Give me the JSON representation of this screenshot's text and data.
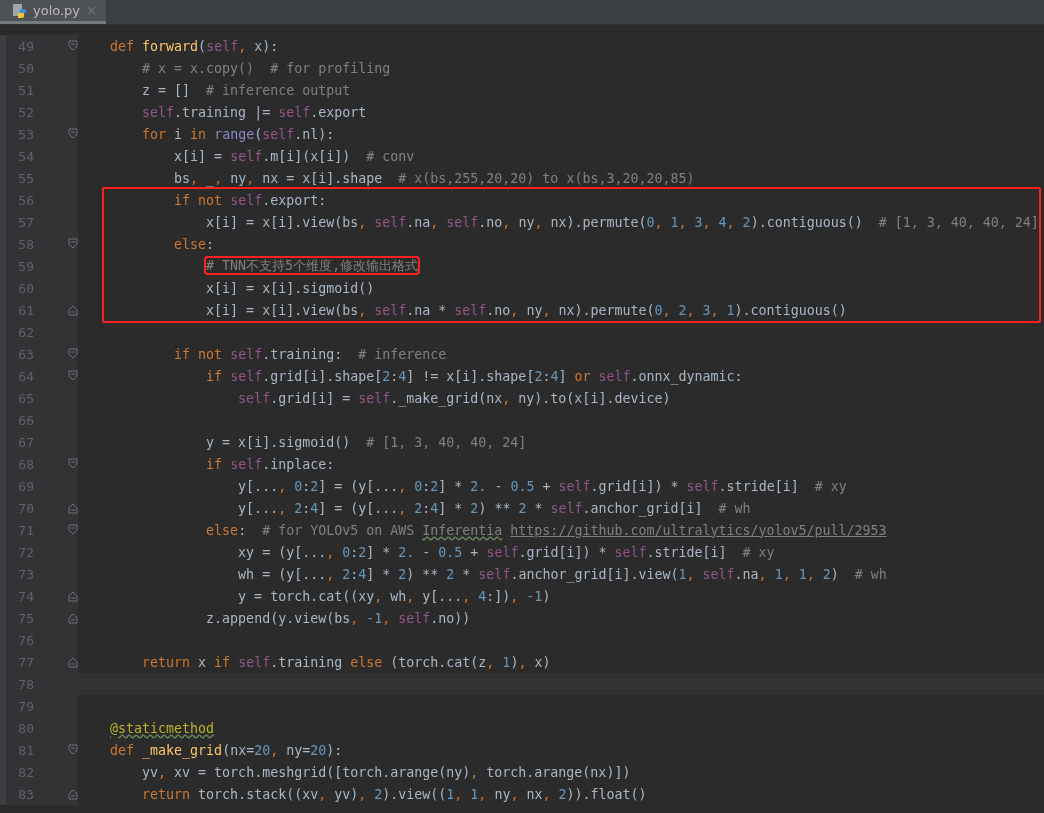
{
  "tab": {
    "title": "yolo.py",
    "selected": true
  },
  "blocks": [
    {
      "kind": "plain",
      "lines": [
        {
          "number": "49",
          "fold_open": true,
          "tokens": [
            {
              "kind": "kw",
              "text": "    def "
            },
            {
              "kind": "fn",
              "text": "forward"
            },
            {
              "kind": "tx",
              "text": "("
            },
            {
              "kind": "self",
              "text": "self"
            },
            {
              "kind": "pu",
              "text": ", "
            },
            {
              "kind": "tx",
              "text": "x):"
            }
          ]
        },
        {
          "number": "50",
          "tokens": [
            {
              "kind": "cm",
              "text": "        # x = x.copy()  # for profiling"
            }
          ]
        },
        {
          "number": "51",
          "tokens": [
            {
              "kind": "tx",
              "text": "        z = []  "
            },
            {
              "kind": "cm",
              "text": "# inference output"
            }
          ]
        },
        {
          "number": "52",
          "tokens": [
            {
              "kind": "self",
              "text": "        self"
            },
            {
              "kind": "tx",
              "text": ".training |= "
            },
            {
              "kind": "self",
              "text": "self"
            },
            {
              "kind": "tx",
              "text": ".export"
            }
          ]
        },
        {
          "number": "53",
          "fold_open": true,
          "tokens": [
            {
              "kind": "kw",
              "text": "        for "
            },
            {
              "kind": "tx",
              "text": "i "
            },
            {
              "kind": "kw",
              "text": "in "
            },
            {
              "kind": "bi",
              "text": "range"
            },
            {
              "kind": "tx",
              "text": "("
            },
            {
              "kind": "self",
              "text": "self"
            },
            {
              "kind": "tx",
              "text": ".nl):"
            }
          ]
        },
        {
          "number": "54",
          "tokens": [
            {
              "kind": "tx",
              "text": "            x[i] = "
            },
            {
              "kind": "self",
              "text": "self"
            },
            {
              "kind": "tx",
              "text": ".m[i](x[i])  "
            },
            {
              "kind": "cm",
              "text": "# conv"
            }
          ]
        },
        {
          "number": "55",
          "tokens": [
            {
              "kind": "tx",
              "text": "            bs"
            },
            {
              "kind": "pu",
              "text": ", "
            },
            {
              "kind": "tx",
              "text": "_"
            },
            {
              "kind": "pu",
              "text": ", "
            },
            {
              "kind": "tx",
              "text": "ny"
            },
            {
              "kind": "pu",
              "text": ", "
            },
            {
              "kind": "tx",
              "text": "nx = x[i].shape  "
            },
            {
              "kind": "cm",
              "text": "# x(bs,255,20,20) to x(bs,3,20,20,85)"
            }
          ]
        }
      ]
    },
    {
      "kind": "boxed",
      "lines": [
        {
          "number": "56",
          "tokens": [
            {
              "kind": "kw",
              "text": "            if not "
            },
            {
              "kind": "self",
              "text": "self"
            },
            {
              "kind": "tx",
              "text": ".export:"
            }
          ]
        },
        {
          "number": "57",
          "tokens": [
            {
              "kind": "tx",
              "text": "                x[i] = x[i].view(bs"
            },
            {
              "kind": "pu",
              "text": ", "
            },
            {
              "kind": "self",
              "text": "self"
            },
            {
              "kind": "tx",
              "text": ".na"
            },
            {
              "kind": "pu",
              "text": ", "
            },
            {
              "kind": "self",
              "text": "self"
            },
            {
              "kind": "tx",
              "text": ".no"
            },
            {
              "kind": "pu",
              "text": ", "
            },
            {
              "kind": "tx",
              "text": "ny"
            },
            {
              "kind": "pu",
              "text": ", "
            },
            {
              "kind": "tx",
              "text": "nx).permute("
            },
            {
              "kind": "num",
              "text": "0"
            },
            {
              "kind": "pu",
              "text": ", "
            },
            {
              "kind": "num",
              "text": "1"
            },
            {
              "kind": "pu",
              "text": ", "
            },
            {
              "kind": "num",
              "text": "3"
            },
            {
              "kind": "pu",
              "text": ", "
            },
            {
              "kind": "num",
              "text": "4"
            },
            {
              "kind": "pu",
              "text": ", "
            },
            {
              "kind": "num",
              "text": "2"
            },
            {
              "kind": "tx",
              "text": ").contiguous()  "
            },
            {
              "kind": "cm",
              "text": "# [1, 3, 40, 40, 24]"
            }
          ]
        },
        {
          "number": "58",
          "fold_open": true,
          "tokens": [
            {
              "kind": "kw",
              "text": "            else"
            },
            {
              "kind": "tx",
              "text": ":"
            }
          ]
        },
        {
          "number": "59",
          "tokens": [
            {
              "kind": "cm",
              "text": "                # TNN不支持5个维度,修改输出格式",
              "boxed": true
            }
          ]
        },
        {
          "number": "60",
          "tokens": [
            {
              "kind": "tx",
              "text": "                x[i] = x[i].sigmoid()"
            }
          ]
        },
        {
          "number": "61",
          "fold_close": true,
          "tokens": [
            {
              "kind": "tx",
              "text": "                x[i] = x[i].view(bs"
            },
            {
              "kind": "pu",
              "text": ", "
            },
            {
              "kind": "self",
              "text": "self"
            },
            {
              "kind": "tx",
              "text": ".na * "
            },
            {
              "kind": "self",
              "text": "self"
            },
            {
              "kind": "tx",
              "text": ".no"
            },
            {
              "kind": "pu",
              "text": ", "
            },
            {
              "kind": "tx",
              "text": "ny"
            },
            {
              "kind": "pu",
              "text": ", "
            },
            {
              "kind": "tx",
              "text": "nx).permute("
            },
            {
              "kind": "num",
              "text": "0"
            },
            {
              "kind": "pu",
              "text": ", "
            },
            {
              "kind": "num",
              "text": "2"
            },
            {
              "kind": "pu",
              "text": ", "
            },
            {
              "kind": "num",
              "text": "3"
            },
            {
              "kind": "pu",
              "text": ", "
            },
            {
              "kind": "num",
              "text": "1"
            },
            {
              "kind": "tx",
              "text": ").contiguous()"
            }
          ]
        }
      ]
    },
    {
      "kind": "plain",
      "lines": [
        {
          "number": "62"
        },
        {
          "number": "63",
          "fold_open": true,
          "tokens": [
            {
              "kind": "kw",
              "text": "            if not "
            },
            {
              "kind": "self",
              "text": "self"
            },
            {
              "kind": "tx",
              "text": ".training:  "
            },
            {
              "kind": "cm",
              "text": "# inference"
            }
          ]
        },
        {
          "number": "64",
          "fold_open": true,
          "tokens": [
            {
              "kind": "kw",
              "text": "                if "
            },
            {
              "kind": "self",
              "text": "self"
            },
            {
              "kind": "tx",
              "text": ".grid[i].shape["
            },
            {
              "kind": "num",
              "text": "2"
            },
            {
              "kind": "tx",
              "text": ":"
            },
            {
              "kind": "num",
              "text": "4"
            },
            {
              "kind": "tx",
              "text": "] != x[i].shape["
            },
            {
              "kind": "num",
              "text": "2"
            },
            {
              "kind": "tx",
              "text": ":"
            },
            {
              "kind": "num",
              "text": "4"
            },
            {
              "kind": "tx",
              "text": "] "
            },
            {
              "kind": "kw",
              "text": "or "
            },
            {
              "kind": "self",
              "text": "self"
            },
            {
              "kind": "tx",
              "text": ".onnx_dynamic:"
            }
          ]
        },
        {
          "number": "65",
          "tokens": [
            {
              "kind": "self",
              "text": "                    self"
            },
            {
              "kind": "tx",
              "text": ".grid[i] = "
            },
            {
              "kind": "self",
              "text": "self"
            },
            {
              "kind": "tx",
              "text": "._make_grid(nx"
            },
            {
              "kind": "pu",
              "text": ", "
            },
            {
              "kind": "tx",
              "text": "ny).to(x[i].device)"
            }
          ]
        },
        {
          "number": "66"
        },
        {
          "number": "67",
          "tokens": [
            {
              "kind": "tx",
              "text": "                y = x[i].sigmoid()  "
            },
            {
              "kind": "cm",
              "text": "# [1, 3, 40, 40, 24]"
            }
          ]
        },
        {
          "number": "68",
          "fold_open": true,
          "tokens": [
            {
              "kind": "kw",
              "text": "                if "
            },
            {
              "kind": "self",
              "text": "self"
            },
            {
              "kind": "tx",
              "text": ".inplace:"
            }
          ]
        },
        {
          "number": "69",
          "tokens": [
            {
              "kind": "tx",
              "text": "                    y[..."
            },
            {
              "kind": "pu",
              "text": ", "
            },
            {
              "kind": "num",
              "text": "0"
            },
            {
              "kind": "tx",
              "text": ":"
            },
            {
              "kind": "num",
              "text": "2"
            },
            {
              "kind": "tx",
              "text": "] = (y[..."
            },
            {
              "kind": "pu",
              "text": ", "
            },
            {
              "kind": "num",
              "text": "0"
            },
            {
              "kind": "tx",
              "text": ":"
            },
            {
              "kind": "num",
              "text": "2"
            },
            {
              "kind": "tx",
              "text": "] * "
            },
            {
              "kind": "num",
              "text": "2."
            },
            {
              "kind": "tx",
              "text": " - "
            },
            {
              "kind": "num",
              "text": "0.5"
            },
            {
              "kind": "tx",
              "text": " + "
            },
            {
              "kind": "self",
              "text": "self"
            },
            {
              "kind": "tx",
              "text": ".grid[i]) * "
            },
            {
              "kind": "self",
              "text": "self"
            },
            {
              "kind": "tx",
              "text": ".stride[i]  "
            },
            {
              "kind": "cm",
              "text": "# xy"
            }
          ]
        },
        {
          "number": "70",
          "fold_close": true,
          "tokens": [
            {
              "kind": "tx",
              "text": "                    y[..."
            },
            {
              "kind": "pu",
              "text": ", "
            },
            {
              "kind": "num",
              "text": "2"
            },
            {
              "kind": "tx",
              "text": ":"
            },
            {
              "kind": "num",
              "text": "4"
            },
            {
              "kind": "tx",
              "text": "] = (y[..."
            },
            {
              "kind": "pu",
              "text": ", "
            },
            {
              "kind": "num",
              "text": "2"
            },
            {
              "kind": "tx",
              "text": ":"
            },
            {
              "kind": "num",
              "text": "4"
            },
            {
              "kind": "tx",
              "text": "] * "
            },
            {
              "kind": "num",
              "text": "2"
            },
            {
              "kind": "tx",
              "text": ") ** "
            },
            {
              "kind": "num",
              "text": "2"
            },
            {
              "kind": "tx",
              "text": " * "
            },
            {
              "kind": "self",
              "text": "self"
            },
            {
              "kind": "tx",
              "text": ".anchor_grid[i]  "
            },
            {
              "kind": "cm",
              "text": "# wh"
            }
          ]
        },
        {
          "number": "71",
          "fold_open": true,
          "tokens": [
            {
              "kind": "kw",
              "text": "                else"
            },
            {
              "kind": "tx",
              "text": ":  "
            },
            {
              "kind": "cm",
              "text": "# for YOLOv5 on AWS "
            },
            {
              "kind": "cm",
              "text": "Inferentia",
              "squiggle": true
            },
            {
              "kind": "link",
              "text": " https://github.com/ultralytics/yolov5/pull/2953"
            }
          ]
        },
        {
          "number": "72",
          "tokens": [
            {
              "kind": "tx",
              "text": "                    xy = (y[..."
            },
            {
              "kind": "pu",
              "text": ", "
            },
            {
              "kind": "num",
              "text": "0"
            },
            {
              "kind": "tx",
              "text": ":"
            },
            {
              "kind": "num",
              "text": "2"
            },
            {
              "kind": "tx",
              "text": "] * "
            },
            {
              "kind": "num",
              "text": "2."
            },
            {
              "kind": "tx",
              "text": " - "
            },
            {
              "kind": "num",
              "text": "0.5"
            },
            {
              "kind": "tx",
              "text": " + "
            },
            {
              "kind": "self",
              "text": "self"
            },
            {
              "kind": "tx",
              "text": ".grid[i]) * "
            },
            {
              "kind": "self",
              "text": "self"
            },
            {
              "kind": "tx",
              "text": ".stride[i]  "
            },
            {
              "kind": "cm",
              "text": "# xy"
            }
          ]
        },
        {
          "number": "73",
          "tokens": [
            {
              "kind": "tx",
              "text": "                    wh = (y[..."
            },
            {
              "kind": "pu",
              "text": ", "
            },
            {
              "kind": "num",
              "text": "2"
            },
            {
              "kind": "tx",
              "text": ":"
            },
            {
              "kind": "num",
              "text": "4"
            },
            {
              "kind": "tx",
              "text": "] * "
            },
            {
              "kind": "num",
              "text": "2"
            },
            {
              "kind": "tx",
              "text": ") ** "
            },
            {
              "kind": "num",
              "text": "2"
            },
            {
              "kind": "tx",
              "text": " * "
            },
            {
              "kind": "self",
              "text": "self"
            },
            {
              "kind": "tx",
              "text": ".anchor_grid[i].view("
            },
            {
              "kind": "num",
              "text": "1"
            },
            {
              "kind": "pu",
              "text": ", "
            },
            {
              "kind": "self",
              "text": "self"
            },
            {
              "kind": "tx",
              "text": ".na"
            },
            {
              "kind": "pu",
              "text": ", "
            },
            {
              "kind": "num",
              "text": "1"
            },
            {
              "kind": "pu",
              "text": ", "
            },
            {
              "kind": "num",
              "text": "1"
            },
            {
              "kind": "pu",
              "text": ", "
            },
            {
              "kind": "num",
              "text": "2"
            },
            {
              "kind": "tx",
              "text": ")  "
            },
            {
              "kind": "cm",
              "text": "# wh"
            }
          ]
        },
        {
          "number": "74",
          "fold_close": true,
          "tokens": [
            {
              "kind": "tx",
              "text": "                    y = torch.cat((xy"
            },
            {
              "kind": "pu",
              "text": ", "
            },
            {
              "kind": "tx",
              "text": "wh"
            },
            {
              "kind": "pu",
              "text": ", "
            },
            {
              "kind": "tx",
              "text": "y[..."
            },
            {
              "kind": "pu",
              "text": ", "
            },
            {
              "kind": "num",
              "text": "4"
            },
            {
              "kind": "tx",
              "text": ":])"
            },
            {
              "kind": "pu",
              "text": ", "
            },
            {
              "kind": "num",
              "text": "-1"
            },
            {
              "kind": "tx",
              "text": ")"
            }
          ]
        },
        {
          "number": "75",
          "fold_close": true,
          "tokens": [
            {
              "kind": "tx",
              "text": "                z.append(y.view(bs"
            },
            {
              "kind": "pu",
              "text": ", "
            },
            {
              "kind": "num",
              "text": "-1"
            },
            {
              "kind": "pu",
              "text": ", "
            },
            {
              "kind": "self",
              "text": "self"
            },
            {
              "kind": "tx",
              "text": ".no))"
            }
          ]
        },
        {
          "number": "76"
        },
        {
          "number": "77",
          "fold_close": true,
          "tokens": [
            {
              "kind": "kw",
              "text": "        return "
            },
            {
              "kind": "tx",
              "text": "x "
            },
            {
              "kind": "kw",
              "text": "if "
            },
            {
              "kind": "self",
              "text": "self"
            },
            {
              "kind": "tx",
              "text": ".training "
            },
            {
              "kind": "kw",
              "text": "else "
            },
            {
              "kind": "tx",
              "text": "(torch.cat(z"
            },
            {
              "kind": "pu",
              "text": ", "
            },
            {
              "kind": "num",
              "text": "1"
            },
            {
              "kind": "tx",
              "text": ")"
            },
            {
              "kind": "pu",
              "text": ", "
            },
            {
              "kind": "tx",
              "text": "x)"
            }
          ]
        },
        {
          "number": "78",
          "current": true
        },
        {
          "number": "79"
        },
        {
          "number": "80",
          "tokens": [
            {
              "kind": "deco",
              "text": "    @staticmethod",
              "squiggle": true
            }
          ]
        },
        {
          "number": "81",
          "fold_open": true,
          "tokens": [
            {
              "kind": "kw",
              "text": "    def "
            },
            {
              "kind": "fn",
              "text": "_make_grid"
            },
            {
              "kind": "tx",
              "text": "(nx="
            },
            {
              "kind": "num",
              "text": "20"
            },
            {
              "kind": "pu",
              "text": ", "
            },
            {
              "kind": "tx",
              "text": "ny="
            },
            {
              "kind": "num",
              "text": "20"
            },
            {
              "kind": "tx",
              "text": "):"
            }
          ]
        },
        {
          "number": "82",
          "tokens": [
            {
              "kind": "tx",
              "text": "        yv"
            },
            {
              "kind": "pu",
              "text": ", "
            },
            {
              "kind": "tx",
              "text": "xv = torch.meshgrid([torch.arange(ny)"
            },
            {
              "kind": "pu",
              "text": ", "
            },
            {
              "kind": "tx",
              "text": "torch.arange(nx)])"
            }
          ]
        },
        {
          "number": "83",
          "fold_close": true,
          "tokens": [
            {
              "kind": "kw",
              "text": "        return "
            },
            {
              "kind": "tx",
              "text": "torch.stack((xv"
            },
            {
              "kind": "pu",
              "text": ", "
            },
            {
              "kind": "tx",
              "text": "yv)"
            },
            {
              "kind": "pu",
              "text": ", "
            },
            {
              "kind": "num",
              "text": "2"
            },
            {
              "kind": "tx",
              "text": ").view(("
            },
            {
              "kind": "num",
              "text": "1"
            },
            {
              "kind": "pu",
              "text": ", "
            },
            {
              "kind": "num",
              "text": "1"
            },
            {
              "kind": "pu",
              "text": ", "
            },
            {
              "kind": "tx",
              "text": "ny"
            },
            {
              "kind": "pu",
              "text": ", "
            },
            {
              "kind": "tx",
              "text": "nx"
            },
            {
              "kind": "pu",
              "text": ", "
            },
            {
              "kind": "num",
              "text": "2"
            },
            {
              "kind": "tx",
              "text": ")).float()"
            }
          ]
        }
      ]
    }
  ]
}
